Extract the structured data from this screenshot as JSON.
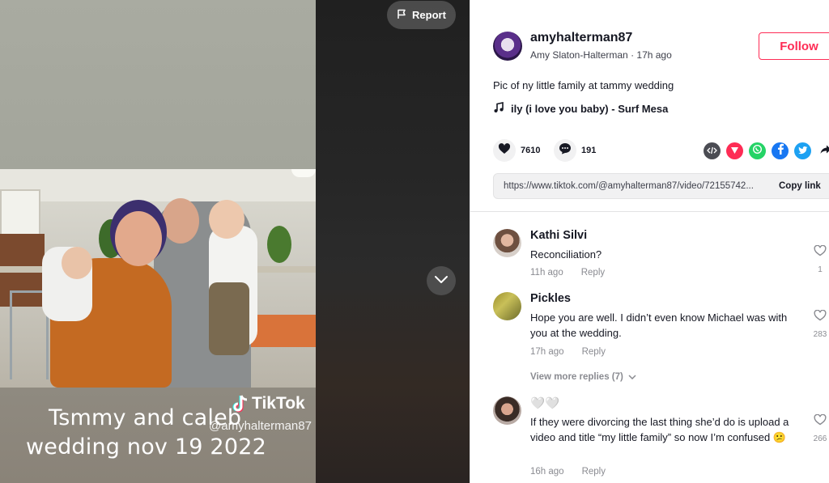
{
  "video": {
    "caption_line1": "Tsmmy and caleb",
    "caption_line2": "wedding nov 19 2022",
    "watermark_brand": "TikTok",
    "watermark_handle": "@amyhalterman87",
    "report_label": "Report"
  },
  "author": {
    "username": "amyhalterman87",
    "display_name": "Amy Slaton-Halterman",
    "posted": "17h ago",
    "follow_label": "Follow"
  },
  "post": {
    "description": "Pic of ny little family at tammy wedding",
    "music": "ily (i love you baby) - Surf Mesa",
    "likes": "7610",
    "comments": "191",
    "link_url": "https://www.tiktok.com/@amyhalterman87/video/72155742...",
    "copy_link_label": "Copy link"
  },
  "comments": [
    {
      "name": "Kathi Silvi",
      "text": "Reconciliation?",
      "time": "11h ago",
      "reply_label": "Reply",
      "likes": "1"
    },
    {
      "name": "Pickles",
      "text": "Hope you are well. I didn’t even know Michael was with you at the wedding.",
      "time": "17h ago",
      "reply_label": "Reply",
      "likes": "283"
    },
    {
      "name": "🤍🤍",
      "text": "If they were divorcing the last thing she’d do is upload a video and title “my little family” so now I’m confused 😕",
      "time": "16h ago",
      "reply_label": "Reply",
      "likes": "266"
    }
  ],
  "view_more_replies": "View more replies (7)",
  "colors": {
    "accent": "#fe2c55",
    "text": "#161823",
    "muted": "#8a8b91"
  }
}
